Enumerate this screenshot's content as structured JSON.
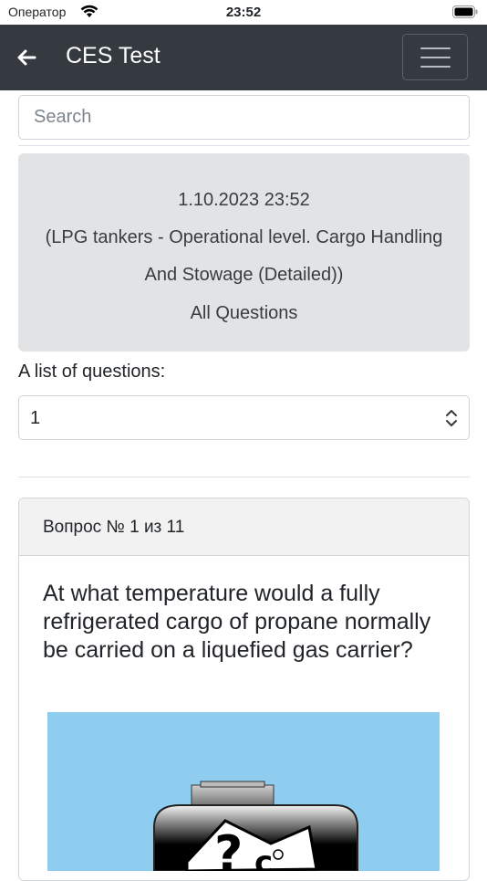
{
  "status_bar": {
    "carrier": "Оператор",
    "time": "23:52"
  },
  "navbar": {
    "title": "CES Test",
    "back_icon": "arrow-left-icon",
    "menu_icon": "hamburger-menu-icon"
  },
  "search": {
    "placeholder": "Search",
    "value": ""
  },
  "info": {
    "datetime": "1.10.2023 23:52",
    "subject_line1": "(LPG tankers - Operational level. Cargo Handling",
    "subject_line2": "And Stowage (Detailed))",
    "mode": "All Questions"
  },
  "question_list": {
    "label": "A list of questions:",
    "selected": "1"
  },
  "question_card": {
    "header": "Вопрос № 1 из 11",
    "text": "At what temperature would a fully refrigerated cargo of propane normally be carried on a liquefied gas carrier?",
    "image_icon": "gas-tank-question-illustration"
  },
  "colors": {
    "navbar_bg": "#343a40",
    "info_bg": "#e2e3e5",
    "image_sky": "#8fcdf0"
  }
}
